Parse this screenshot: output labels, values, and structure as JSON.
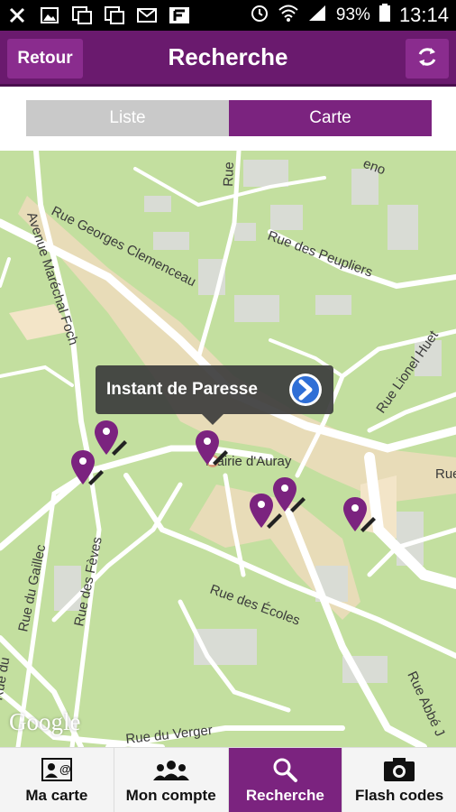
{
  "status": {
    "battery": "93%",
    "time": "13:14"
  },
  "header": {
    "back_label": "Retour",
    "title": "Recherche",
    "refresh_icon": "refresh-icon"
  },
  "view_toggle": {
    "list_label": "Liste",
    "map_label": "Carte",
    "selected": "Carte"
  },
  "map": {
    "callout_title": "Instant de Paresse",
    "townhall": "Mairie d'Auray",
    "attribution": "Google",
    "streets": [
      "Rue Georges Clemenceau",
      "Avenue Maréchal Foch",
      "Rue des Peupliers",
      "Rue Lionel Huet",
      "Rue du Gaillec",
      "Rue des Fèves",
      "Rue des Écoles",
      "Rue du Verger",
      "Rue Abbé J",
      "Rue du",
      "Rue",
      "Rue",
      "eno"
    ],
    "pin_color": "#7b237f"
  },
  "tabs": [
    {
      "label": "Ma carte",
      "icon": "card-user-icon"
    },
    {
      "label": "Mon compte",
      "icon": "people-icon"
    },
    {
      "label": "Recherche",
      "icon": "search-icon"
    },
    {
      "label": "Flash codes",
      "icon": "camera-icon"
    }
  ]
}
